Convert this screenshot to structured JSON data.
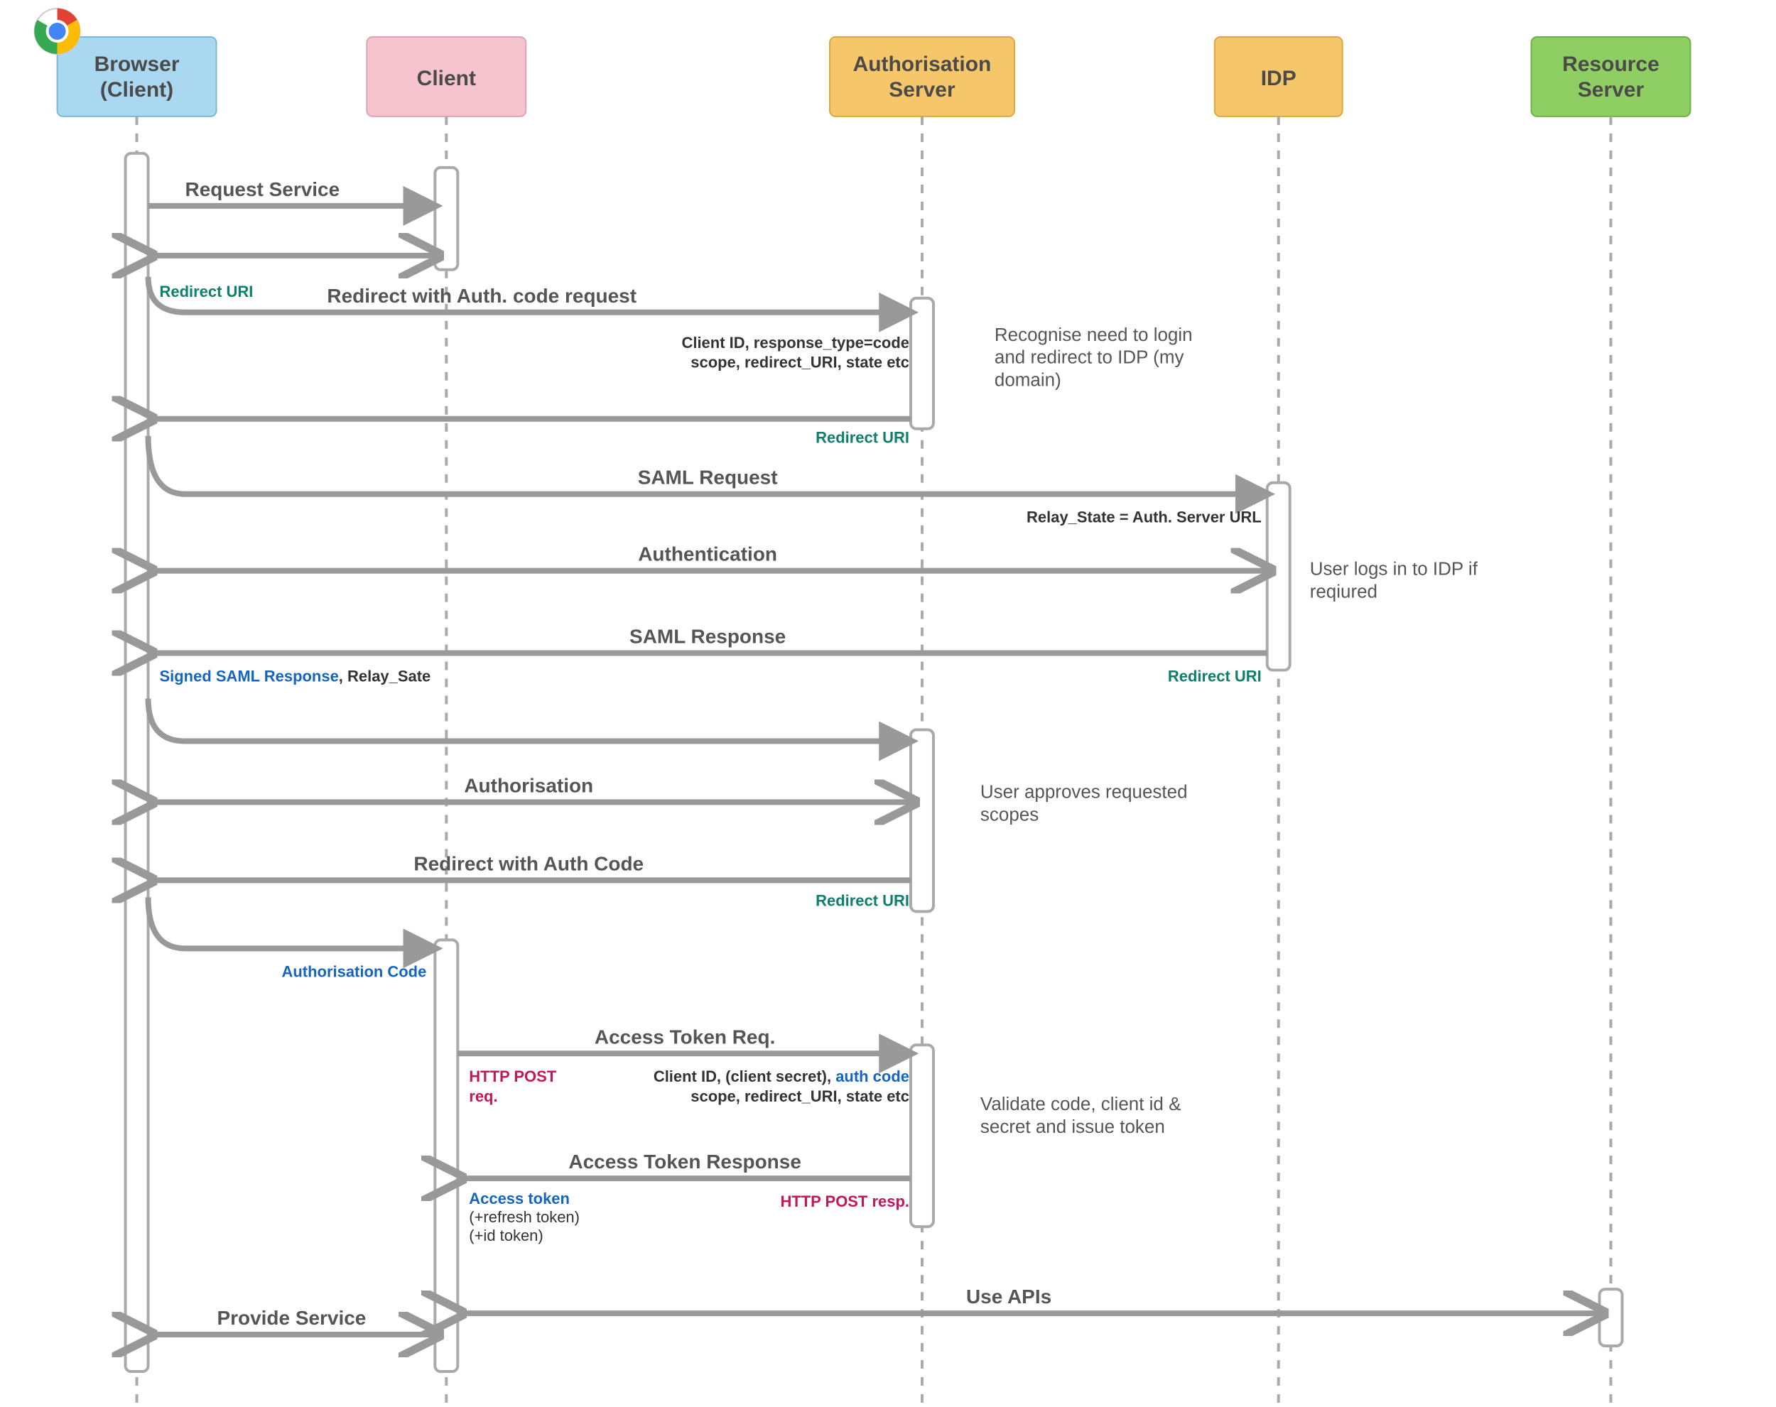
{
  "lifelines": {
    "browser": "Browser\n(Client)",
    "client": "Client",
    "auth_server": "Authorisation\nServer",
    "idp": "IDP",
    "resource": "Resource\nServer"
  },
  "colors": {
    "browser": "#a9d8f0",
    "client": "#f5c4cf",
    "auth_server": "#f6c66b",
    "idp": "#f6c66b",
    "resource": "#8fce62",
    "teal": "#0d7f6b",
    "pink": "#c2185b",
    "blue": "#1565c0"
  },
  "labels": {
    "request_service": "Request Service",
    "redirect_uri": "Redirect URI",
    "redirect_auth_req": "Redirect with Auth. code request",
    "client_id_line1": "Client ID, response_type=code",
    "client_id_line2": "scope, redirect_URI, state etc",
    "recognise_login1": "Recognise need to login",
    "recognise_login2": "and redirect to IDP (my",
    "recognise_login3": "domain)",
    "saml_request": "SAML Request",
    "relay_state_auth": "Relay_State = Auth. Server URL",
    "authentication": "Authentication",
    "user_logs_in1": "User logs in to IDP if",
    "user_logs_in2": "reqiured",
    "saml_response": "SAML Response",
    "signed_saml": "Signed SAML Response",
    "relay_sate": "Relay_Sate",
    "authorisation": "Authorisation",
    "user_approves1": "User approves requested",
    "user_approves2": "scopes",
    "redirect_auth_code": "Redirect with Auth Code",
    "authorisation_code": "Authorisation Code",
    "access_token_req": "Access Token Req.",
    "http_post_req1": "HTTP POST",
    "http_post_req2": "req.",
    "atr_line1a": "Client ID, (client secret), ",
    "atr_line1b": "auth code",
    "atr_line2": "scope, redirect_URI, state etc",
    "validate1": "Validate code, client id &",
    "validate2": "secret and issue token",
    "access_token_resp": "Access Token Response",
    "http_post_resp": "HTTP POST resp.",
    "access_token": "Access token",
    "refresh_token": "(+refresh token)",
    "id_token": "(+id token)",
    "use_apis": "Use APIs",
    "provide_service": "Provide Service"
  }
}
